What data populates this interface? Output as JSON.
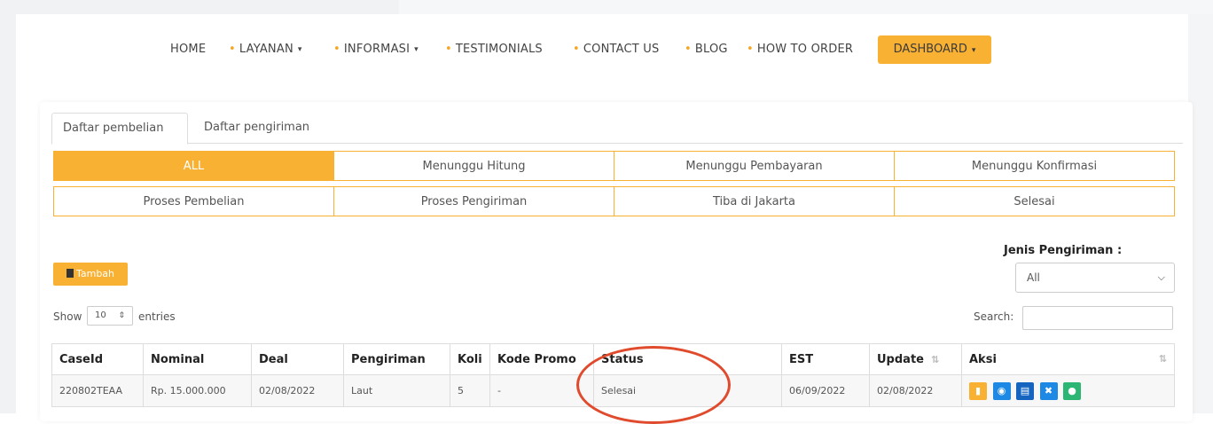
{
  "nav": {
    "home": "HOME",
    "layanan": "LAYANAN",
    "informasi": "INFORMASI",
    "testimonials": "TESTIMONIALS",
    "contact": "CONTACT US",
    "blog": "BLOG",
    "how_to_order": "HOW TO ORDER",
    "dashboard": "DASHBOARD",
    "caret": "▾",
    "bullet": "•"
  },
  "tabs": {
    "pembelian": "Daftar pembelian",
    "pengiriman": "Daftar pengiriman"
  },
  "filters": {
    "all": "ALL",
    "menunggu_hitung": "Menunggu Hitung",
    "menunggu_pembayaran": "Menunggu Pembayaran",
    "menunggu_konfirmasi": "Menunggu Konfirmasi",
    "proses_pembelian": "Proses Pembelian",
    "proses_pengiriman": "Proses Pengiriman",
    "tiba": "Tiba di Jakarta",
    "selesai": "Selesai"
  },
  "toolbar": {
    "tambah": "Tambah",
    "jenis_label": "Jenis Pengiriman :",
    "jenis_value": "All",
    "show": "Show",
    "show_value": "10",
    "entries": "entries",
    "search": "Search:"
  },
  "table": {
    "headers": {
      "caseid": "CaseId",
      "nominal": "Nominal",
      "deal": "Deal",
      "pengiriman": "Pengiriman",
      "koli": "Koli",
      "kode_promo": "Kode Promo",
      "status": "Status",
      "est": "EST",
      "update": "Update",
      "aksi": "Aksi"
    },
    "row": {
      "caseid": "220802TEAA",
      "nominal": "Rp. 15.000.000",
      "deal": "02/08/2022",
      "pengiriman": "Laut",
      "koli": "5",
      "kode_promo": "-",
      "status": "Selesai",
      "est": "06/09/2022",
      "update": "02/08/2022"
    }
  },
  "colors": {
    "accent": "#f8b133",
    "annotation": "#e04a2d",
    "blue": "#1e88e5",
    "green": "#2bb673"
  }
}
